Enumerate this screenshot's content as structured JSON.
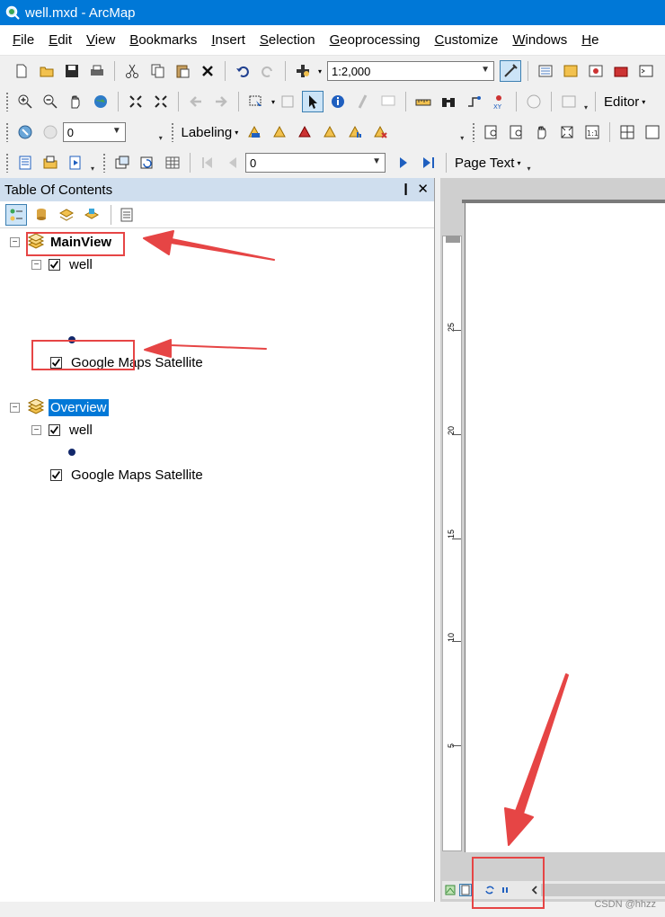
{
  "window": {
    "title": "well.mxd - ArcMap"
  },
  "menu": [
    {
      "label": "File",
      "accel": "F",
      "rest": "ile"
    },
    {
      "label": "Edit",
      "accel": "E",
      "rest": "dit"
    },
    {
      "label": "View",
      "accel": "V",
      "rest": "iew"
    },
    {
      "label": "Bookmarks",
      "accel": "B",
      "rest": "ookmarks"
    },
    {
      "label": "Insert",
      "accel": "I",
      "rest": "nsert"
    },
    {
      "label": "Selection",
      "accel": "S",
      "rest": "election"
    },
    {
      "label": "Geoprocessing",
      "accel": "G",
      "rest": "eoprocessing"
    },
    {
      "label": "Customize",
      "accel": "C",
      "rest": "ustomize"
    },
    {
      "label": "Windows",
      "accel": "W",
      "rest": "indows"
    },
    {
      "label": "Help",
      "accel": "H",
      "rest": "e"
    }
  ],
  "toolbar": {
    "scale": "1:2,000",
    "editor_label": "Editor",
    "labeling_label": "Labeling",
    "georef_value": "0",
    "page_value": "0",
    "page_text_label": "Page Text"
  },
  "toc": {
    "title": "Table Of Contents",
    "pin": "❙",
    "close": "✕",
    "frames": [
      {
        "name": "MainView",
        "layers": [
          {
            "name": "well",
            "checked": true
          },
          {
            "name": "Google Maps Satellite",
            "checked": true
          }
        ]
      },
      {
        "name": "Overview",
        "layers": [
          {
            "name": "well",
            "checked": true
          },
          {
            "name": "Google Maps Satellite",
            "checked": true
          }
        ]
      }
    ]
  },
  "ruler": {
    "labels": [
      "25",
      "20",
      "15",
      "10",
      "5"
    ]
  },
  "colors": {
    "titlebar": "#0078d7",
    "annotation": "#e64545",
    "selection": "#0078d7",
    "point_symbol": "#12286b"
  },
  "watermark": "CSDN @hhzz"
}
